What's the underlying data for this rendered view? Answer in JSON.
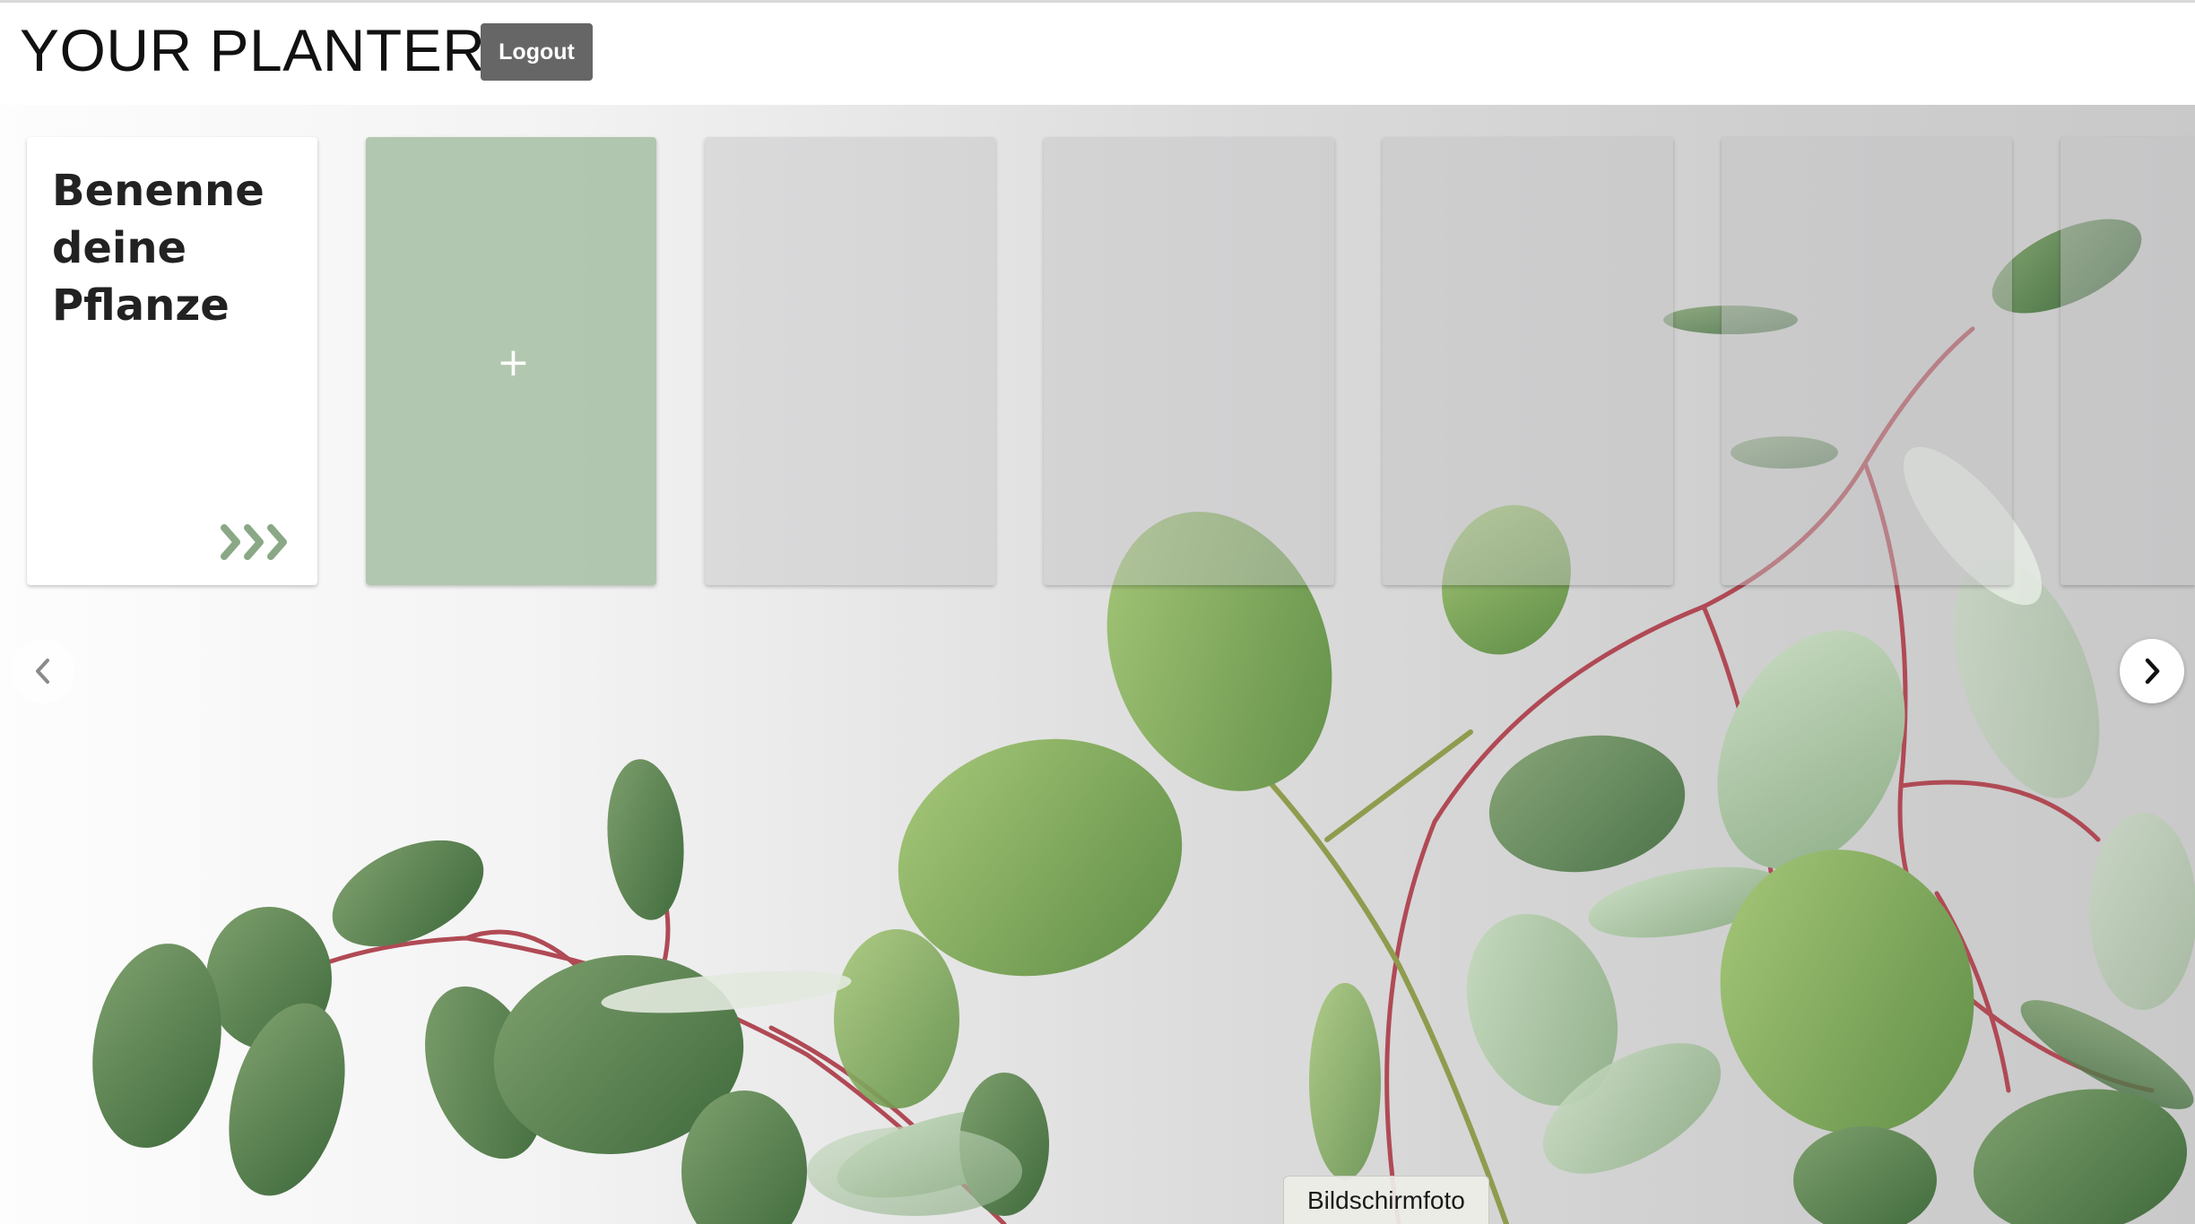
{
  "header": {
    "title": "YOUR PLANTER",
    "logout_label": "Logout"
  },
  "carousel": {
    "name_card": {
      "title": "Benenne deine Pflanze",
      "arrow_icon": "triple-chevron-right-icon"
    },
    "add_card": {
      "symbol": "+"
    },
    "empty_slots_visible": 5,
    "prev_icon": "chevron-left-icon",
    "next_icon": "chevron-right-icon"
  },
  "tooltip": {
    "text": "Bildschirmfoto"
  },
  "colors": {
    "header_bg": "#ffffff",
    "logout_bg": "#666666",
    "add_card_bg": "#a0bb9d",
    "arrow_color": "#8aa886",
    "leaf_green": "#6f9a52",
    "stem_red": "#b04a55"
  }
}
